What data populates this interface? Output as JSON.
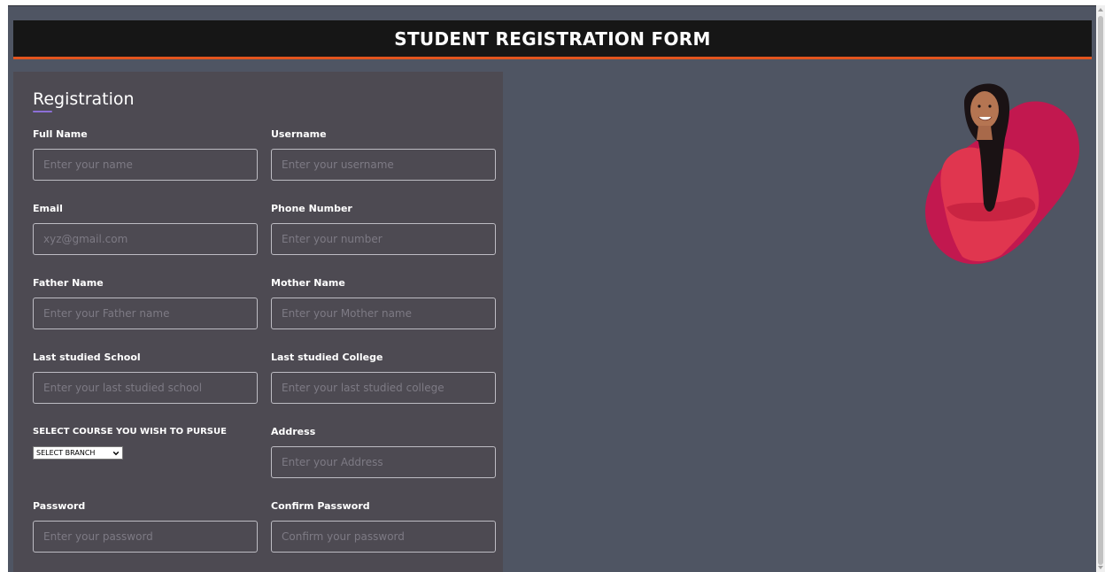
{
  "header": {
    "title": "STUDENT REGISTRATION FORM"
  },
  "form": {
    "title": "Registration",
    "fields": {
      "full_name": {
        "label": "Full Name",
        "placeholder": "Enter your name"
      },
      "username": {
        "label": "Username",
        "placeholder": "Enter your username"
      },
      "email": {
        "label": "Email",
        "placeholder": "xyz@gmail.com"
      },
      "phone": {
        "label": "Phone Number",
        "placeholder": "Enter your number"
      },
      "father": {
        "label": "Father Name",
        "placeholder": "Enter your Father name"
      },
      "mother": {
        "label": "Mother Name",
        "placeholder": "Enter your Mother name"
      },
      "school": {
        "label": "Last studied School",
        "placeholder": "Enter your last studied school"
      },
      "college": {
        "label": "Last studied College",
        "placeholder": "Enter your last studied college"
      },
      "course": {
        "label": "SELECT COURSE YOU WISH TO PURSUE",
        "selected": "SELECT BRANCH"
      },
      "address": {
        "label": "Address",
        "placeholder": "Enter your Address"
      },
      "password": {
        "label": "Password",
        "placeholder": "Enter your password"
      },
      "confirm": {
        "label": "Confirm Password",
        "placeholder": "Confirm your password"
      }
    }
  },
  "colors": {
    "background": "#4f5563",
    "panel": "#4d4a52",
    "header": "#161616",
    "header_accent": "#e2541e",
    "title_underline": "#8c6fd6",
    "blob": "#c2184f",
    "shirt": "#e0364f"
  },
  "icons": {
    "select_arrow": "chevron-down-icon"
  }
}
